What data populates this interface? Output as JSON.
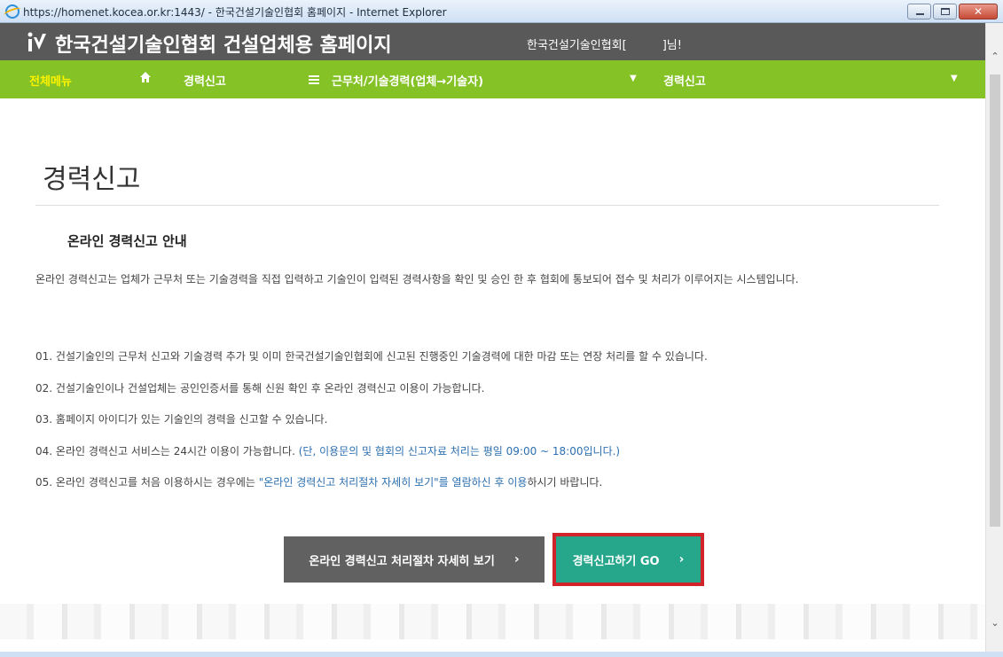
{
  "window": {
    "title": "https://homenet.kocea.or.kr:1443/ - 한국건설기술인협회 홈페이지 - Internet Explorer",
    "close_glyph": "✕"
  },
  "header": {
    "site_title": "한국건설기술인협회 건설업체용 홈페이지",
    "greeting_left": "한국건설기술인협회[",
    "greeting_right": "]님!"
  },
  "nav": {
    "all_menu": "전체메뉴",
    "crumb1": "경력신고",
    "crumb2": "근무처/기술경력(업체→기술자)",
    "crumb3": "경력신고",
    "chevron": "▼"
  },
  "main": {
    "page_title": "경력신고",
    "section_title": "온라인 경력신고 안내",
    "intro": "온라인 경력신고는 업체가 근무처 또는 기술경력을 직접 입력하고 기술인이 입력된 경력사항을 확인 및 승인 한 후 협회에 통보되어 접수 및 처리가 이루어지는 시스템입니다.",
    "items": [
      "01. 건설기술인의 근무처 신고와 기술경력 추가 및 이미 한국건설기술인협회에 신고된 진행중인 기술경력에 대한 마감 또는 연장 처리를 할 수 있습니다.",
      "02. 건설기술인이나 건설업체는 공인인증서를 통해 신원 확인 후 온라인 경력신고 이용이 가능합니다.",
      "03. 홈페이지 아이디가 있는 기술인의 경력을 신고할 수 있습니다."
    ],
    "item4_a": "04. 온라인 경력신고 서비스는 24시간 이용이 가능합니다. ",
    "item4_b": "(단, 이용문의 및 협회의 신고자료 처리는 평일 09:00 ~ 18:00입니다.)",
    "item5_a": "05. 온라인 경력신고를 처음 이용하시는 경우에는 ",
    "item5_b": "\"온라인 경력신고 처리절차 자세히 보기\"를 열람하신 후 이용",
    "item5_c": "하시기 바랍니다.",
    "btn_detail": "온라인 경력신고 처리절차 자세히 보기",
    "btn_go": "경력신고하기 GO",
    "arrow": "›"
  },
  "scroll": {
    "up": "⌃",
    "down": "⌄"
  },
  "colors": {
    "nav": "#84c225",
    "header": "#595959",
    "go_button": "#26a68a",
    "highlight": "#d2232a"
  }
}
